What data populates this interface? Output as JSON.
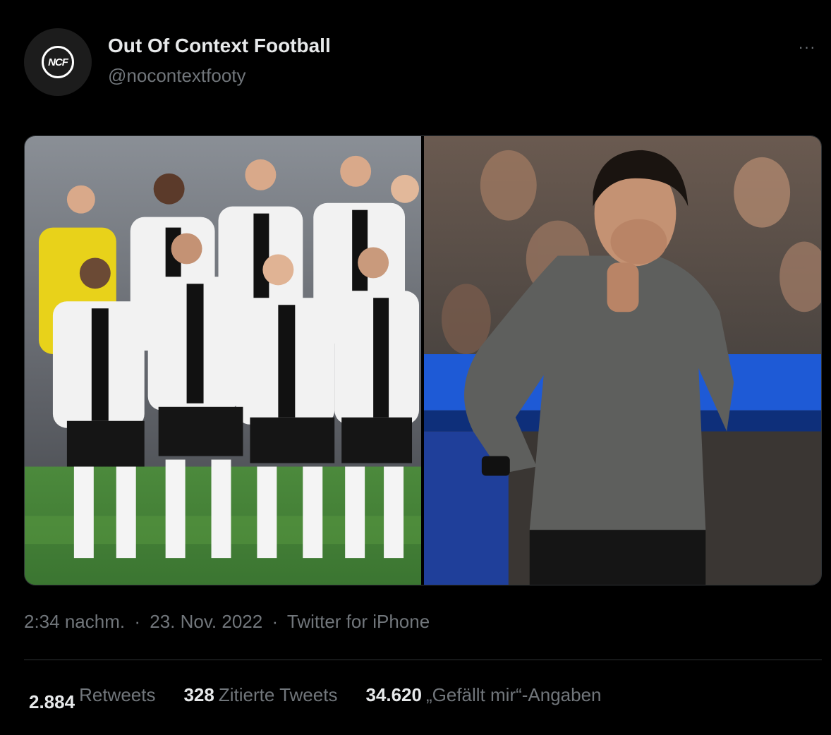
{
  "author": {
    "display_name": "Out Of Context Football",
    "handle": "@nocontextfooty",
    "avatar_text": "NCF",
    "more_label": "···"
  },
  "meta": {
    "time": "2:34 nachm.",
    "separator": "·",
    "date": "23. Nov. 2022",
    "source": "Twitter for iPhone"
  },
  "stats": [
    {
      "number": "2.884",
      "label": "Retweets"
    },
    {
      "number": "328",
      "label": "Zitierte Tweets"
    },
    {
      "number": "34.620",
      "label": "„Gefällt mir“-Angaben"
    }
  ],
  "colors": {
    "background": "#000000",
    "text_primary": "#e7e9ea",
    "text_secondary": "#71767b",
    "border": "#2f3336"
  },
  "icons": {
    "more": "more-horizontal-icon"
  }
}
